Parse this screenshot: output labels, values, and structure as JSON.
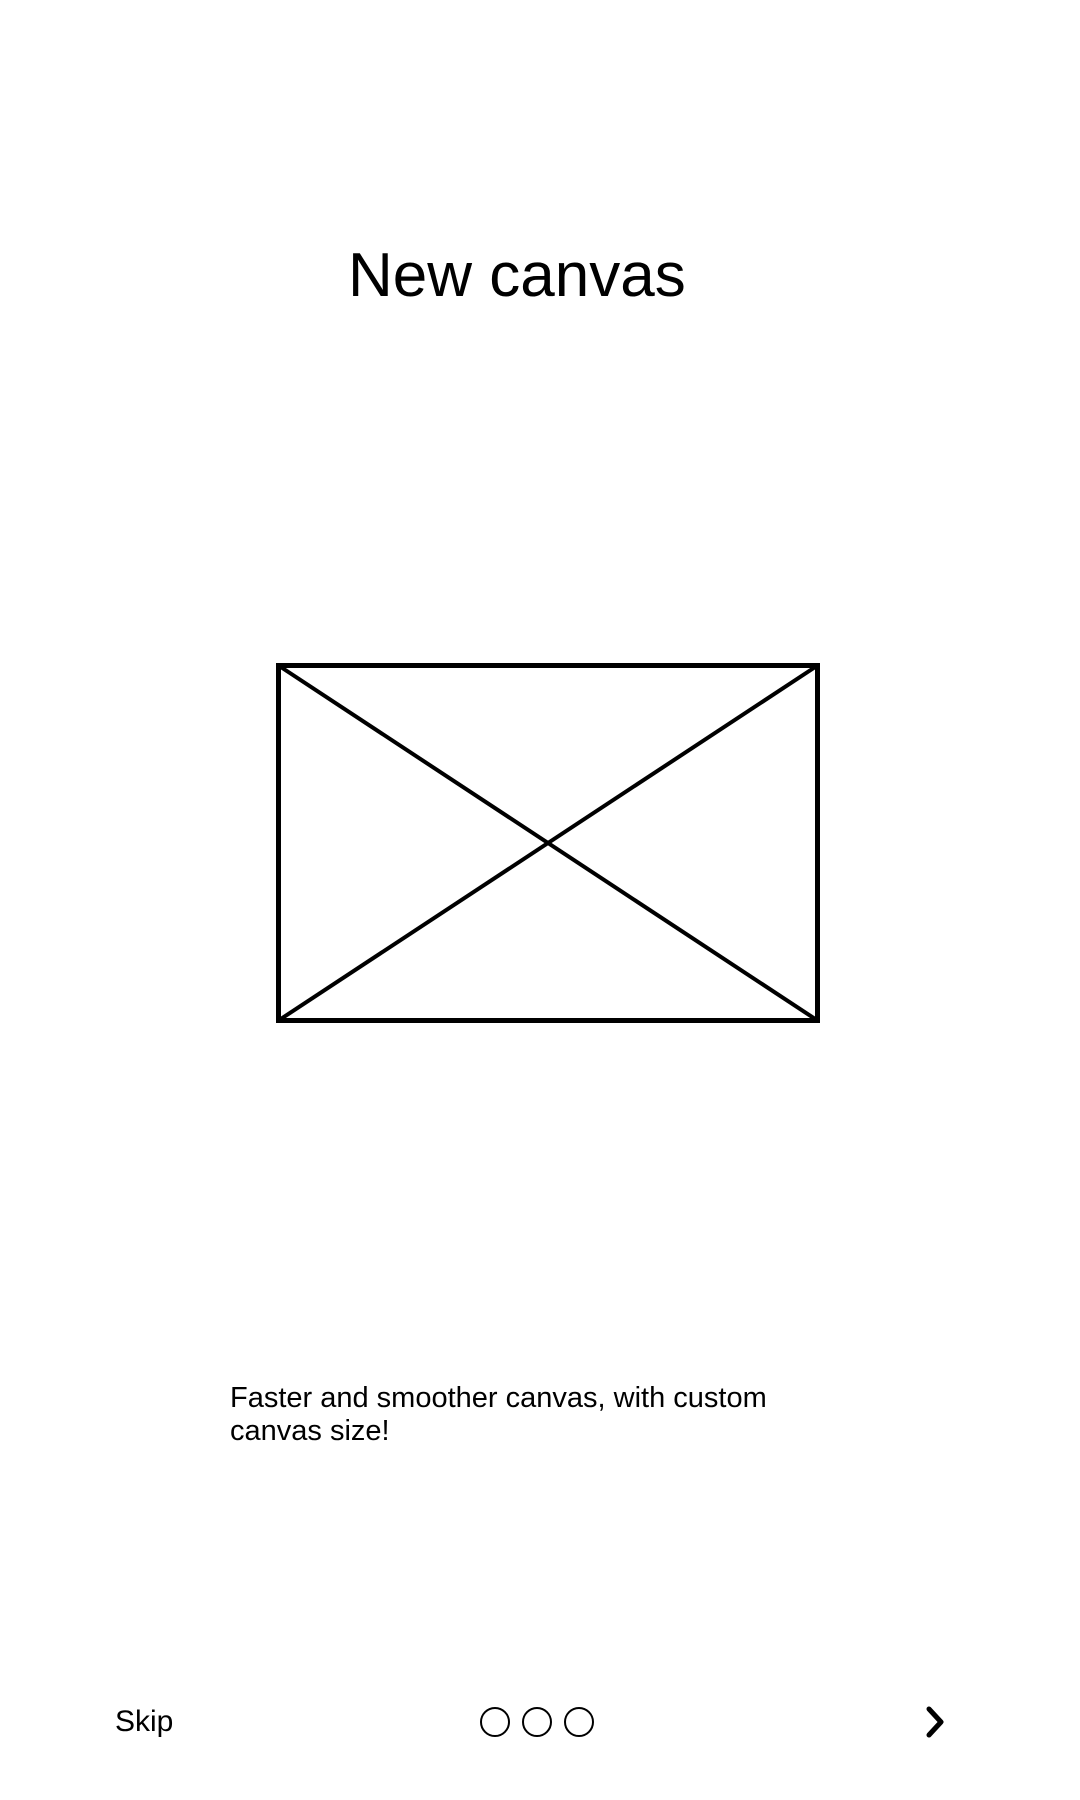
{
  "onboarding": {
    "title": "New canvas",
    "image_icon": "image-placeholder-icon",
    "description": "Faster and smoother canvas, with custom canvas size!"
  },
  "navigation": {
    "skip_label": "Skip",
    "page_indicator": {
      "total_pages": 3,
      "dot_icon": "circle-outline-icon"
    },
    "next_icon": "chevron-right-icon"
  }
}
